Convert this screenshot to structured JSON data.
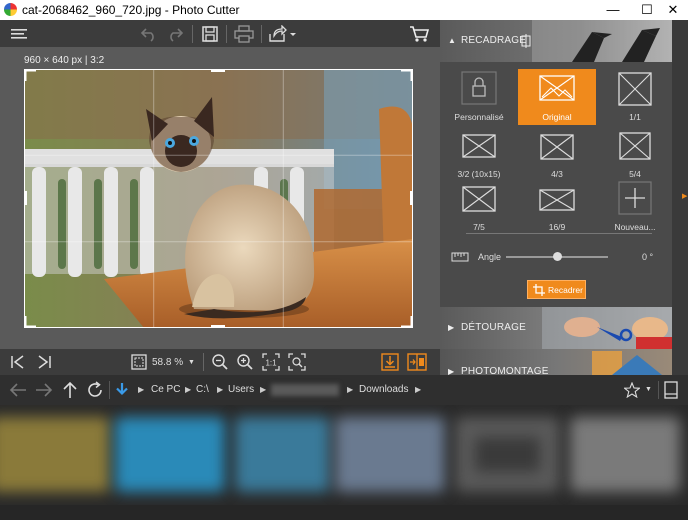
{
  "window": {
    "title": "cat-2068462_960_720.jpg - Photo Cutter"
  },
  "canvas": {
    "dimensions": "960 × 640 px | 3:2"
  },
  "sidebar": {
    "recadrage_title": "RECADRAGE",
    "ratios": [
      {
        "label": "Personnalisé"
      },
      {
        "label": "Original"
      },
      {
        "label": "1/1"
      },
      {
        "label": "3/2 (10x15)"
      },
      {
        "label": "4/3"
      },
      {
        "label": "5/4"
      },
      {
        "label": "7/5"
      },
      {
        "label": "16/9"
      },
      {
        "label": "Nouveau..."
      }
    ],
    "angle_label": "Angle",
    "angle_value": "0 °",
    "angle_fraction": 0.5,
    "crop_button": "Recadrer",
    "detourage_title": "DÉTOURAGE",
    "photomontage_title": "PHOTOMONTAGE"
  },
  "bottombar": {
    "zoom": "58.8 %"
  },
  "pathbar": {
    "crumbs": [
      "Ce PC",
      "C:\\",
      "Users",
      "Downloads"
    ]
  },
  "colors": {
    "accent": "#f08a1c",
    "panel": "#4a4a4a",
    "canvas": "#5a5a5a"
  }
}
